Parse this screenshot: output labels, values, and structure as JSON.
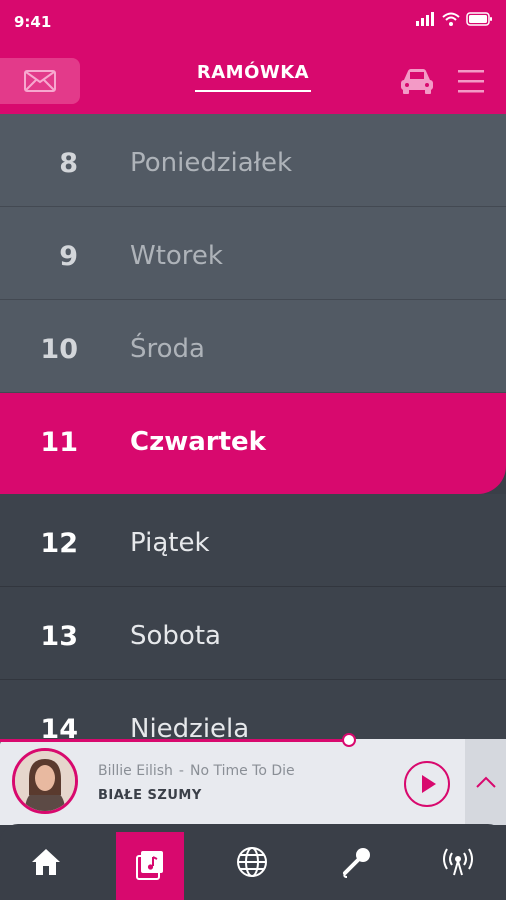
{
  "status_bar": {
    "time": "9:41"
  },
  "header": {
    "title": "RAMÓWKA"
  },
  "days": [
    {
      "number": "8",
      "name": "Poniedziałek",
      "state": "past"
    },
    {
      "number": "9",
      "name": "Wtorek",
      "state": "past"
    },
    {
      "number": "10",
      "name": "Środa",
      "state": "past"
    },
    {
      "number": "11",
      "name": "Czwartek",
      "state": "active"
    },
    {
      "number": "12",
      "name": "Piątek",
      "state": "future"
    },
    {
      "number": "13",
      "name": "Sobota",
      "state": "future"
    },
    {
      "number": "14",
      "name": "Niedziela",
      "state": "future"
    }
  ],
  "player": {
    "artist": "Billie Eilish",
    "separator": "-",
    "title": "No Time To Die",
    "station": "BIAŁE SZUMY",
    "progress": 0.69
  },
  "tabs": [
    {
      "icon": "home-icon",
      "active": false
    },
    {
      "icon": "schedule-music-icon",
      "active": true
    },
    {
      "icon": "globe-icon",
      "active": false
    },
    {
      "icon": "microphone-icon",
      "active": false
    },
    {
      "icon": "broadcast-icon",
      "active": false
    }
  ],
  "colors": {
    "accent": "#d8096e",
    "dark": "#3a3f48",
    "past_row": "#525a64"
  }
}
